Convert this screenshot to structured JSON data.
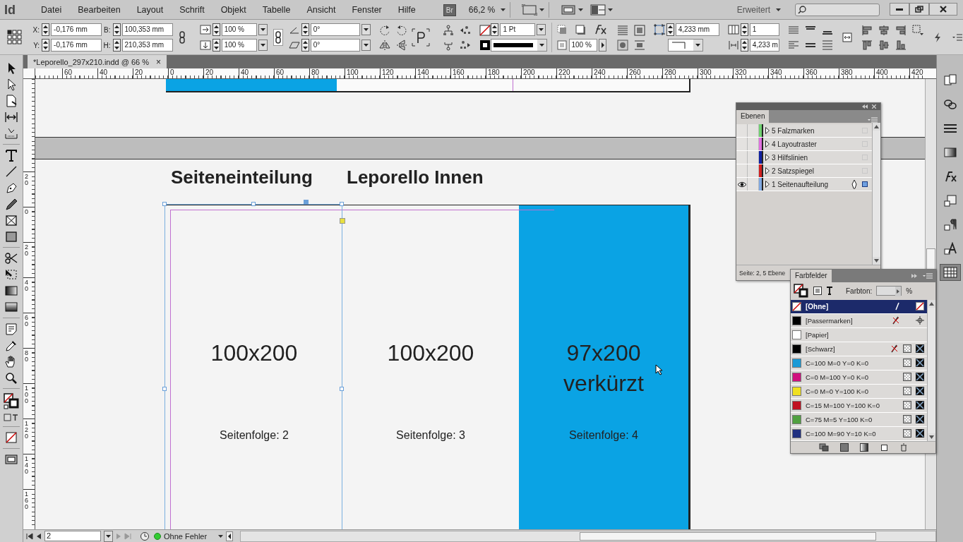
{
  "app_logo": "Id",
  "menu": [
    "Datei",
    "Bearbeiten",
    "Layout",
    "Schrift",
    "Objekt",
    "Tabelle",
    "Ansicht",
    "Fenster",
    "Hilfe"
  ],
  "bridge": "Br",
  "zoom": "66,2 %",
  "workspace": "Erweitert",
  "control_panel": {
    "position": [
      {
        "label": "X:",
        "value": "-0,176 mm"
      },
      {
        "label": "Y:",
        "value": "-0,176 mm"
      }
    ],
    "size": [
      {
        "label": "B:",
        "value": "100,353 mm"
      },
      {
        "label": "H:",
        "value": "210,353 mm"
      }
    ],
    "scale": [
      "100 %",
      "100 %"
    ],
    "angles": [
      "0°",
      "0°"
    ],
    "stroke_weight": "1 Pt",
    "opacity": "100 %",
    "offset": "4,233 mm",
    "columns": "1",
    "gutter": "4,233 m"
  },
  "document_tab": {
    "title": "*Leporello_297x210.indd @ 66 %",
    "close": "×"
  },
  "horizontal_ruler": [
    "60",
    "40",
    "20",
    "0",
    "20",
    "40",
    "60",
    "80",
    "100",
    "120",
    "140",
    "160",
    "180",
    "200",
    "220",
    "240",
    "260",
    "280",
    "300",
    "320",
    "340",
    "360",
    "380",
    "400",
    "420"
  ],
  "vertical_ruler": [
    "20",
    "0",
    "20",
    "40",
    "60",
    "80",
    "100",
    "120",
    "140",
    "160"
  ],
  "spread": {
    "headings": [
      "Seiteneinteilung",
      "Leporello Innen"
    ],
    "panels": [
      {
        "size": "100x200",
        "sequence": "Seitenfolge: 2",
        "color": "#f4f4f4"
      },
      {
        "size": "100x200",
        "sequence": "Seitenfolge: 3",
        "color": "#f4f4f4"
      },
      {
        "size": "97x200 verkürzt",
        "sequence": "Seitenfolge: 4",
        "color": "#0aa3e4"
      }
    ]
  },
  "layers_panel": {
    "title": "Ebenen",
    "layers": [
      {
        "name": "5 Falzmarken",
        "color": "#70d070",
        "visible": false,
        "selected": false
      },
      {
        "name": "4 Layoutraster",
        "color": "#e070e0",
        "visible": false,
        "selected": false
      },
      {
        "name": "3 Hilfslinien",
        "color": "#1020a0",
        "visible": false,
        "selected": false
      },
      {
        "name": "2 Satzspiegel",
        "color": "#d02020",
        "visible": false,
        "selected": false
      },
      {
        "name": "1 Seitenaufteilung",
        "color": "#80a8e0",
        "visible": true,
        "selected": true
      }
    ],
    "status": "Seite: 2, 5 Ebene"
  },
  "swatches_panel": {
    "title": "Farbfelder",
    "tint_label": "Farbton:",
    "tint_unit": "%",
    "swatches": [
      {
        "name": "[Ohne]",
        "kind": "none",
        "selected": true
      },
      {
        "name": "[Passermarken]",
        "kind": "registration",
        "color": "#000000",
        "selected": false
      },
      {
        "name": "[Papier]",
        "kind": "paper",
        "color": "#ffffff",
        "selected": false
      },
      {
        "name": "[Schwarz]",
        "kind": "locked",
        "color": "#000000",
        "selected": false
      },
      {
        "name": "C=100 M=0 Y=0 K=0",
        "kind": "process",
        "color": "#1a9ad6",
        "selected": false
      },
      {
        "name": "C=0 M=100 Y=0 K=0",
        "kind": "process",
        "color": "#d0117e",
        "selected": false
      },
      {
        "name": "C=0 M=0 Y=100 K=0",
        "kind": "process",
        "color": "#f0e020",
        "selected": false
      },
      {
        "name": "C=15 M=100 Y=100 K=0",
        "kind": "process",
        "color": "#c01020",
        "selected": false
      },
      {
        "name": "C=75 M=5 Y=100 K=0",
        "kind": "process",
        "color": "#50a040",
        "selected": false
      },
      {
        "name": "C=100 M=90 Y=10 K=0",
        "kind": "process",
        "color": "#203080",
        "selected": false
      }
    ]
  },
  "status_bar": {
    "page": "2",
    "preflight": "Ohne Fehler"
  }
}
